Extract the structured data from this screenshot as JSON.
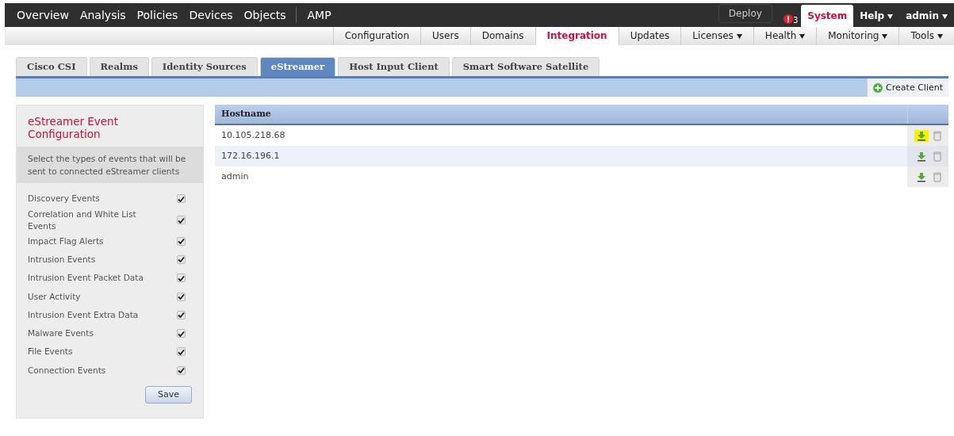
{
  "main_nav": {
    "items": [
      {
        "label": "Overview"
      },
      {
        "label": "Analysis"
      },
      {
        "label": "Policies"
      },
      {
        "label": "Devices"
      },
      {
        "label": "Objects"
      },
      {
        "label": "AMP"
      }
    ],
    "deploy": "Deploy",
    "alert_count": "3",
    "right_items": [
      {
        "label": "System",
        "selected": true,
        "dropdown": false
      },
      {
        "label": "Help",
        "selected": false,
        "dropdown": true
      },
      {
        "label": "admin",
        "selected": false,
        "dropdown": true
      }
    ]
  },
  "sub_nav": [
    {
      "label": "Configuration",
      "selected": false,
      "dropdown": false
    },
    {
      "label": "Users",
      "selected": false,
      "dropdown": false
    },
    {
      "label": "Domains",
      "selected": false,
      "dropdown": false
    },
    {
      "label": "Integration",
      "selected": true,
      "dropdown": false
    },
    {
      "label": "Updates",
      "selected": false,
      "dropdown": false
    },
    {
      "label": "Licenses",
      "selected": false,
      "dropdown": true
    },
    {
      "label": "Health",
      "selected": false,
      "dropdown": true
    },
    {
      "label": "Monitoring",
      "selected": false,
      "dropdown": true
    },
    {
      "label": "Tools",
      "selected": false,
      "dropdown": true
    }
  ],
  "tabs": [
    {
      "label": "Cisco CSI",
      "selected": false
    },
    {
      "label": "Realms",
      "selected": false
    },
    {
      "label": "Identity Sources",
      "selected": false
    },
    {
      "label": "eStreamer",
      "selected": true
    },
    {
      "label": "Host Input Client",
      "selected": false
    },
    {
      "label": "Smart Software Satellite",
      "selected": false
    }
  ],
  "create_button": "Create Client",
  "config_panel": {
    "title": "eStreamer Event Configuration",
    "description": "Select the types of events that will be sent to connected eStreamer clients",
    "events": [
      {
        "label": "Discovery Events",
        "checked": true
      },
      {
        "label": "Correlation and White List Events",
        "checked": true
      },
      {
        "label": "Impact Flag Alerts",
        "checked": true
      },
      {
        "label": "Intrusion Events",
        "checked": true
      },
      {
        "label": "Intrusion Event Packet Data",
        "checked": true
      },
      {
        "label": "User Activity",
        "checked": true
      },
      {
        "label": "Intrusion Event Extra Data",
        "checked": true
      },
      {
        "label": "Malware Events",
        "checked": true
      },
      {
        "label": "File Events",
        "checked": true
      },
      {
        "label": "Connection Events",
        "checked": true
      }
    ],
    "save": "Save"
  },
  "table": {
    "columns": [
      "Hostname"
    ],
    "rows": [
      {
        "hostname": "10.105.218.68",
        "highlighted": true
      },
      {
        "hostname": "172.16.196.1",
        "highlighted": false
      },
      {
        "hostname": "admin",
        "highlighted": false
      }
    ]
  }
}
